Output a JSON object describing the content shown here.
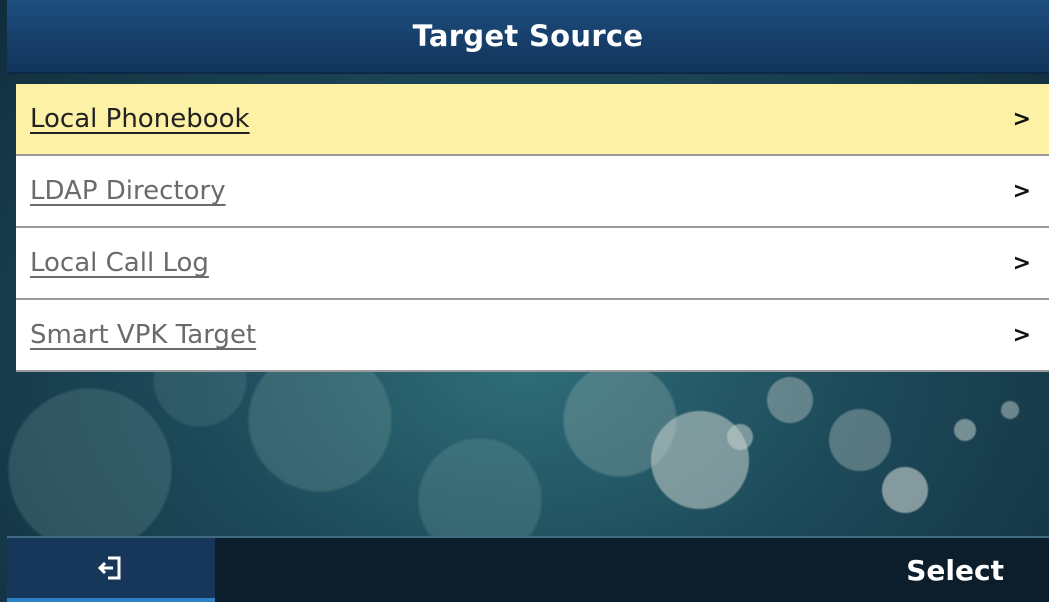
{
  "header": {
    "title": "Target Source"
  },
  "menu": {
    "items": [
      {
        "label": "Local Phonebook",
        "chevron": ">"
      },
      {
        "label": "LDAP Directory",
        "chevron": ">"
      },
      {
        "label": "Local Call Log",
        "chevron": ">"
      },
      {
        "label": "Smart VPK Target",
        "chevron": ">"
      }
    ]
  },
  "softkeys": {
    "back_icon": "exit-icon",
    "select_label": "Select"
  },
  "colors": {
    "header_bg": "#173f6a",
    "selected_row": "#fdf1a6",
    "softkey_bar": "#0c1e2c",
    "back_key_bg": "#17375a"
  }
}
